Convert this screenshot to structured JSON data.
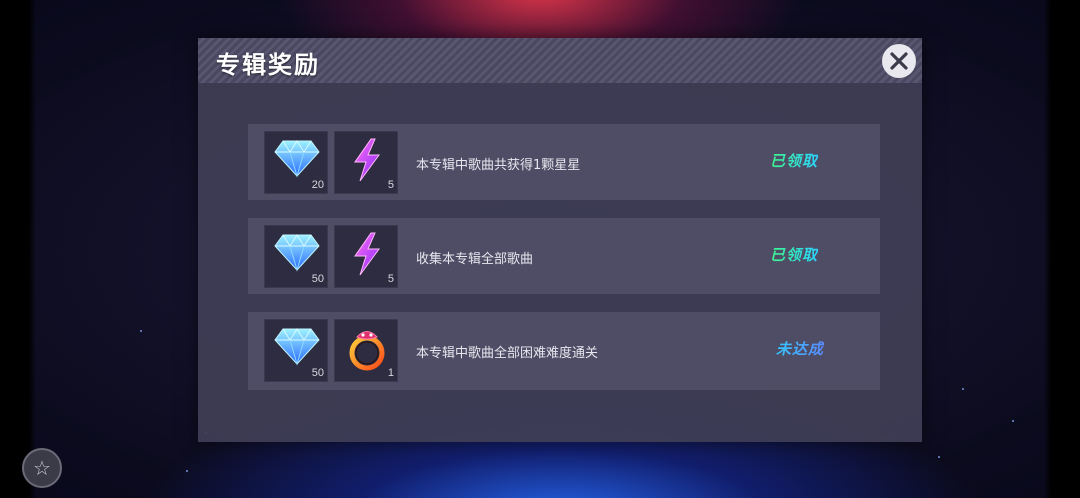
{
  "dialog": {
    "title": "专辑奖励",
    "close_icon": "close-icon"
  },
  "rewards": [
    {
      "description": "本专辑中歌曲共获得1颗星星",
      "status": "已领取",
      "items": [
        {
          "icon": "diamond-icon",
          "count": "20"
        },
        {
          "icon": "lightning-icon",
          "count": "5"
        }
      ]
    },
    {
      "description": "收集本专辑全部歌曲",
      "status": "已领取",
      "items": [
        {
          "icon": "diamond-icon",
          "count": "50"
        },
        {
          "icon": "lightning-icon",
          "count": "5"
        }
      ]
    },
    {
      "description": "本专辑中歌曲全部困难难度通关",
      "status": "未达成",
      "items": [
        {
          "icon": "diamond-icon",
          "count": "50"
        },
        {
          "icon": "ring-icon",
          "count": "1"
        }
      ]
    }
  ],
  "colors": {
    "claimed": "#3cf0b0",
    "pending": "#2ab8ff",
    "panel": "#403e56"
  }
}
